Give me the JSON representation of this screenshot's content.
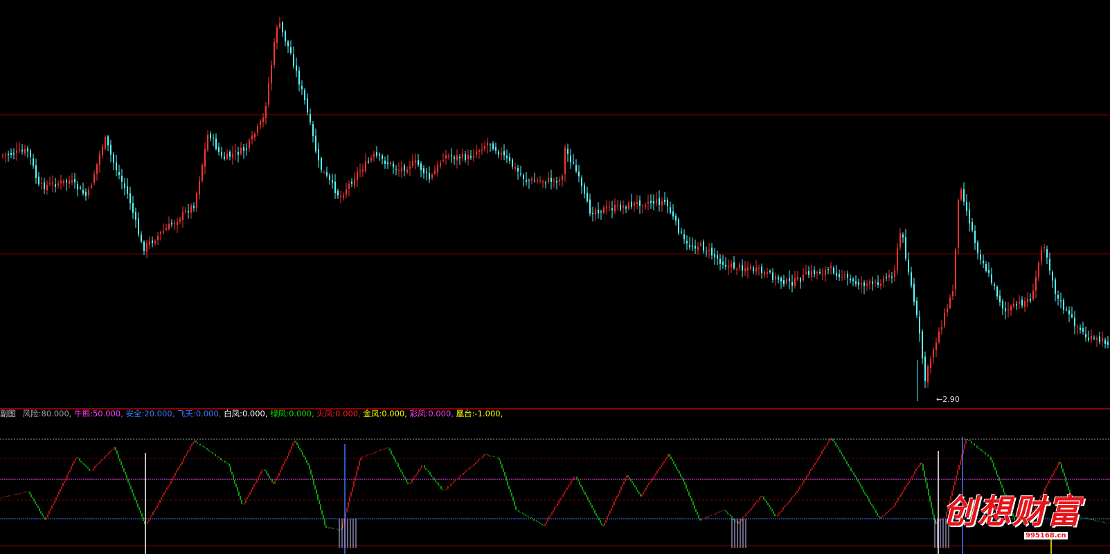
{
  "main_chart": {
    "low_marker": "←2.90"
  },
  "indicator": {
    "name": "副图",
    "items": [
      {
        "label": "风险:",
        "value": "80.000,",
        "color": "#a0a0a0"
      },
      {
        "label": "牛熊:",
        "value": "50.000,",
        "color": "#ff40ff"
      },
      {
        "label": "安全:",
        "value": "20.000,",
        "color": "#3c78ff"
      },
      {
        "label": "飞天:",
        "value": "0.000,",
        "color": "#3c78ff"
      },
      {
        "label": "白凤:",
        "value": "0.000,",
        "color": "#ffffff"
      },
      {
        "label": "绿凤:",
        "value": "0.000,",
        "color": "#00e000"
      },
      {
        "label": "火凤:",
        "value": "0.000,",
        "color": "#ff2020"
      },
      {
        "label": "金凤:",
        "value": "0.000,",
        "color": "#ffff00"
      },
      {
        "label": "彩凤:",
        "value": "0.000,",
        "color": "#ff40ff"
      },
      {
        "label": "凰台:",
        "value": "-1.000,",
        "color": "#ffff00"
      }
    ]
  },
  "watermark": {
    "text": "创想财富",
    "url": "995168.cn"
  },
  "colors": {
    "up": "#ff3232",
    "down": "#54ffff",
    "grid": "#800000",
    "indicator_up": "#e01818",
    "indicator_down": "#10c010",
    "line_80": "#a0a0a0",
    "line_50": "#ff40ff",
    "line_20": "#3c78ff"
  }
}
